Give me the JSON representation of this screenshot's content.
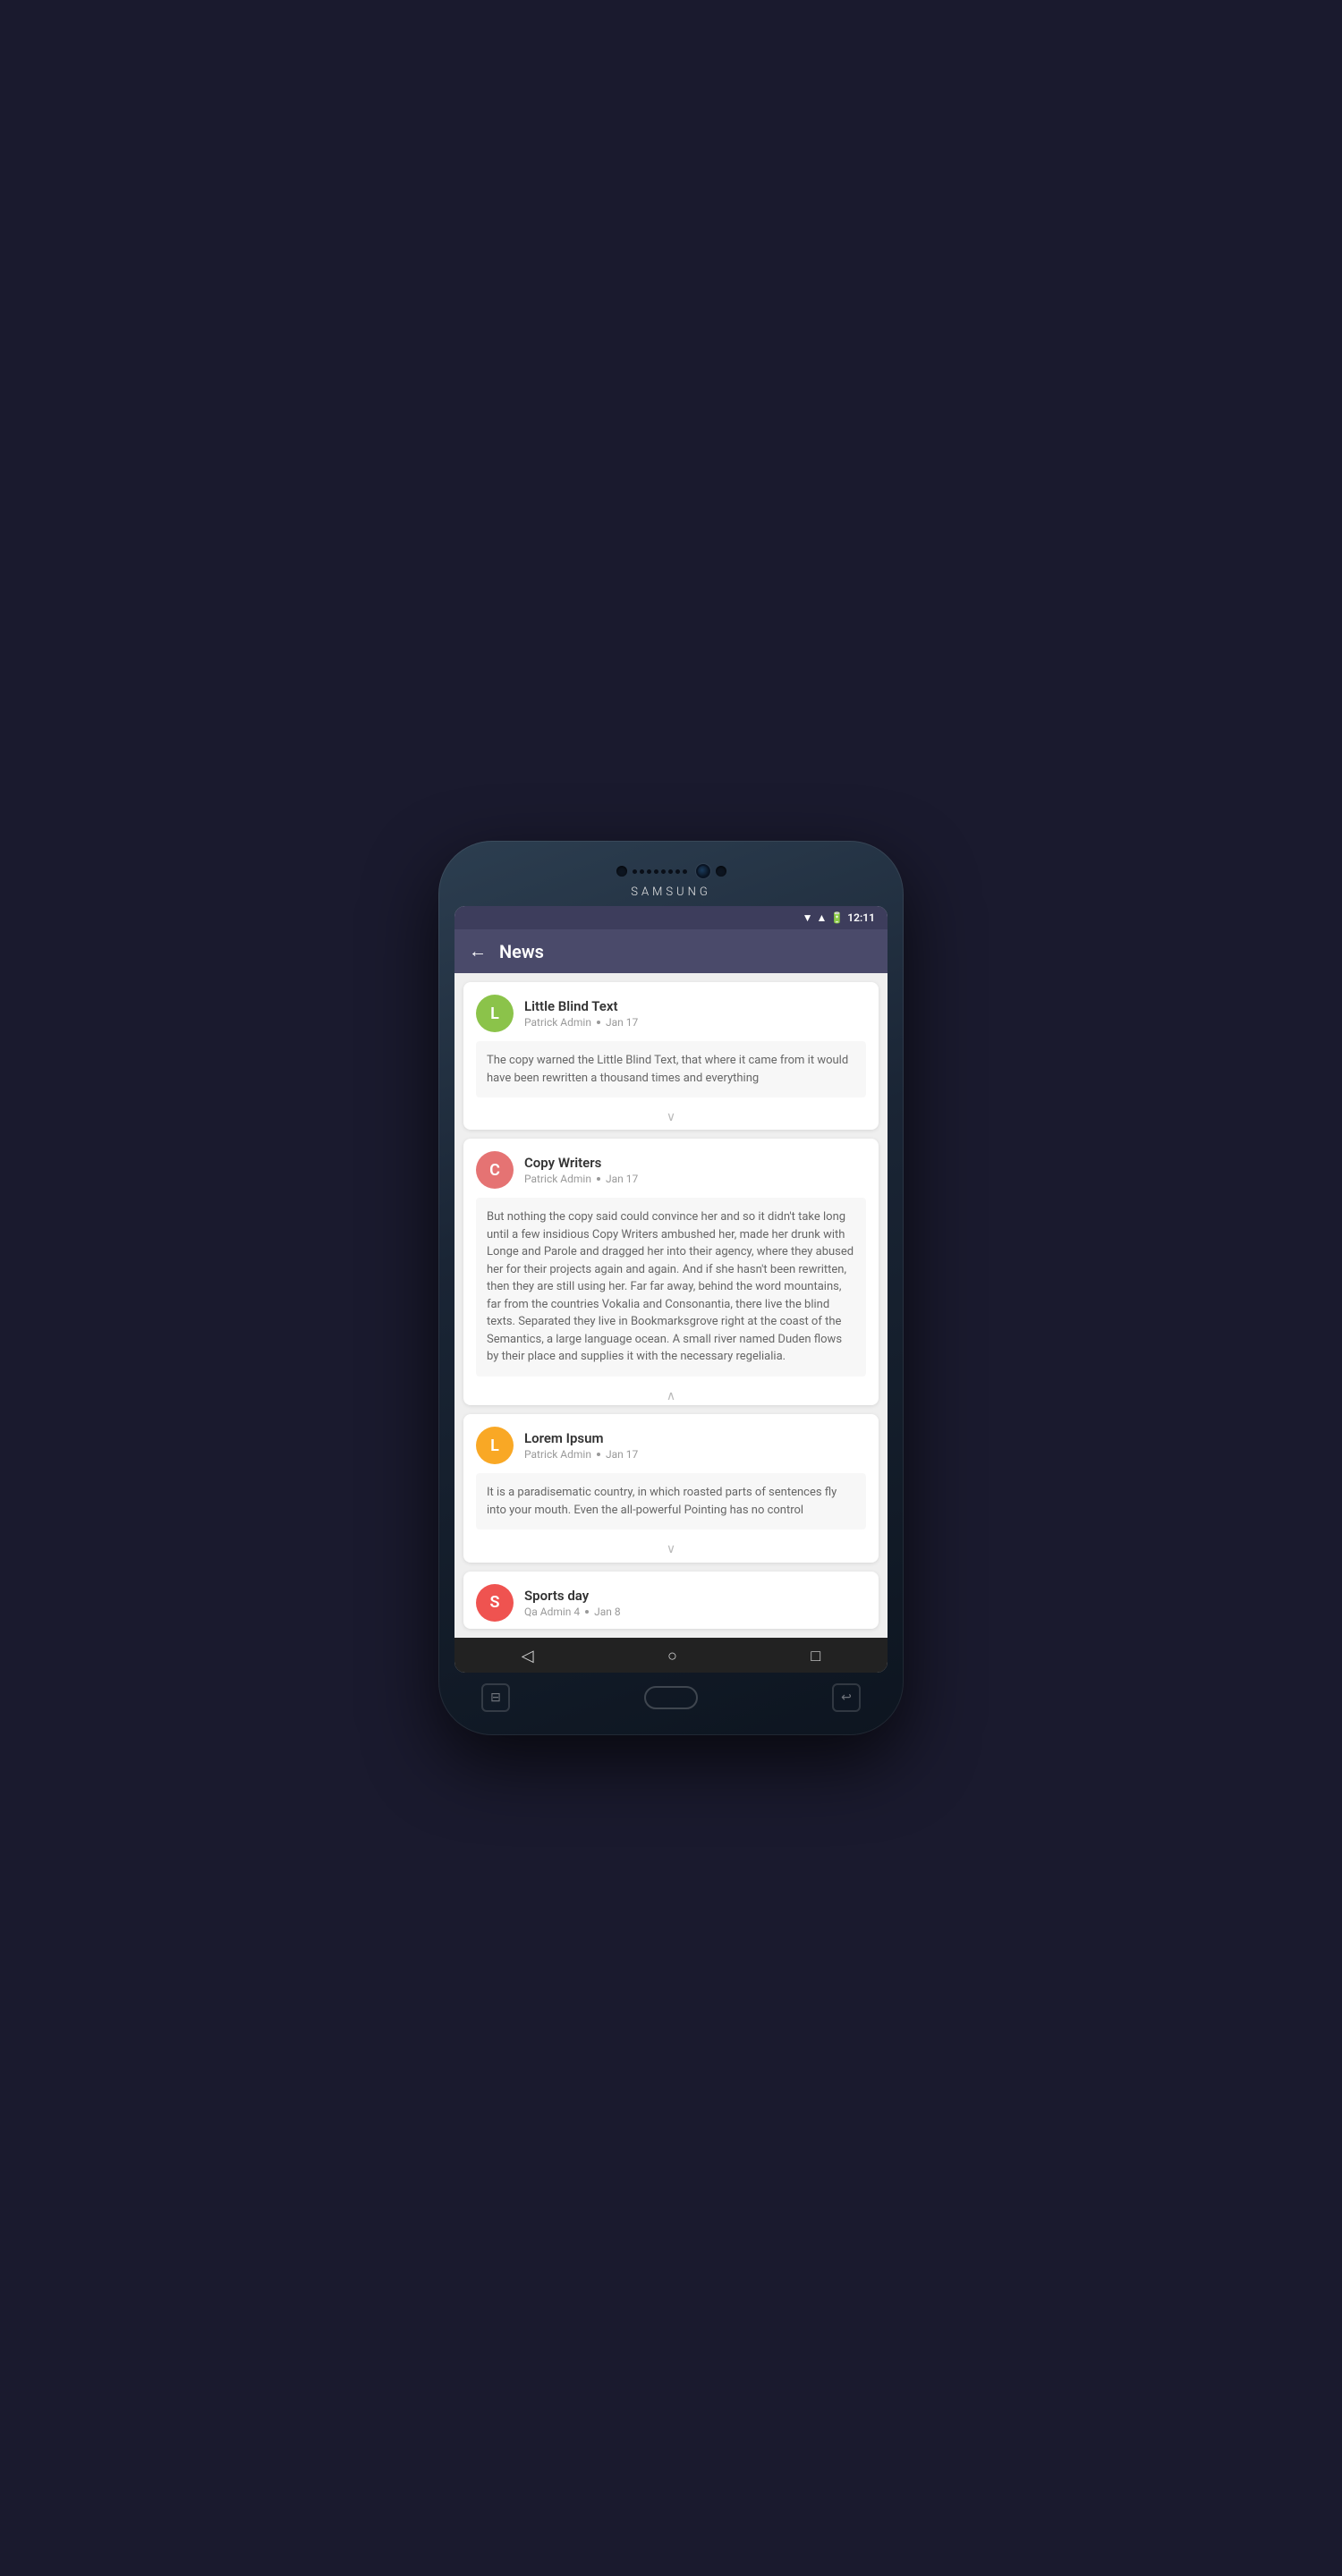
{
  "device": {
    "brand": "SAMSUNG",
    "time": "12:11"
  },
  "statusBar": {
    "time": "12:11"
  },
  "header": {
    "title": "News",
    "back_label": "←"
  },
  "news": [
    {
      "id": "little-blind-text",
      "avatar_letter": "L",
      "avatar_color": "avatar-green",
      "title": "Little Blind Text",
      "author": "Patrick Admin",
      "date": "Jan 17",
      "body": "The copy warned the Little Blind Text, that where it came from it would have been rewritten a thousand times and everything",
      "expanded": false,
      "chevron": "∨"
    },
    {
      "id": "copy-writers",
      "avatar_letter": "C",
      "avatar_color": "avatar-red",
      "title": "Copy Writers",
      "author": "Patrick Admin",
      "date": "Jan 17",
      "body": "But nothing the copy said could convince her and so it didn't take long until a few insidious Copy Writers ambushed her, made her drunk with Longe and Parole and dragged her into their agency, where they abused her for their projects again and again. And if she hasn't been rewritten, then they are still using her. Far far away, behind the word mountains, far from the countries Vokalia and Consonantia, there live the blind texts. Separated they live in Bookmarksgrove right at the coast of the Semantics, a large language ocean. A small river named Duden flows by their place and supplies it with the necessary regelialia.",
      "expanded": true,
      "chevron": "∧"
    },
    {
      "id": "lorem-ipsum",
      "avatar_letter": "L",
      "avatar_color": "avatar-yellow",
      "title": "Lorem Ipsum",
      "author": "Patrick Admin",
      "date": "Jan 17",
      "body": "It is a paradisematic country, in which roasted parts of sentences fly into your mouth. Even the all-powerful Pointing has no control",
      "expanded": false,
      "chevron": "∨"
    },
    {
      "id": "sports-day",
      "avatar_letter": "S",
      "avatar_color": "avatar-pink",
      "title": "Sports day",
      "author": "Qa Admin 4",
      "date": "Jan 8",
      "body": "",
      "expanded": false,
      "chevron": "∨"
    }
  ],
  "bottomNav": {
    "back": "◁",
    "home": "○",
    "recent": "□"
  },
  "hardware": {
    "left_icon": "⊟",
    "right_icon": "↩"
  }
}
